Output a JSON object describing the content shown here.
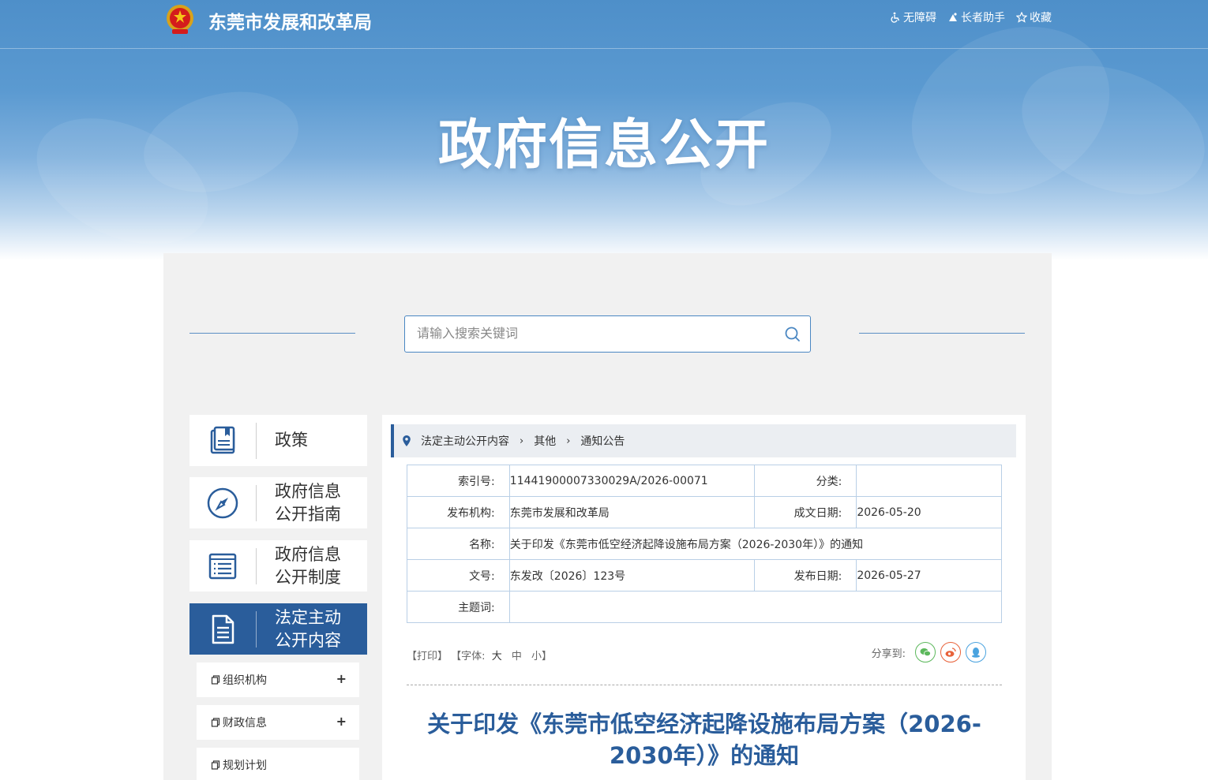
{
  "header": {
    "site_name": "东莞市发展和改革局",
    "tools": [
      {
        "label": "无障碍",
        "icon": "wheelchair-icon"
      },
      {
        "label": "长者助手",
        "icon": "elder-helper-icon"
      },
      {
        "label": "收藏",
        "icon": "star-icon"
      }
    ],
    "banner_title": "政府信息公开"
  },
  "search": {
    "placeholder": "请输入搜索关键词",
    "icon": "search-icon"
  },
  "sidebar": {
    "items": [
      {
        "label": "政策",
        "icon": "policy-book-icon",
        "active": false
      },
      {
        "label": "政府信息\n公开指南",
        "icon": "compass-icon",
        "active": false
      },
      {
        "label": "政府信息\n公开制度",
        "icon": "list-document-icon",
        "active": false
      },
      {
        "label": "法定主动\n公开内容",
        "icon": "document-icon",
        "active": true
      }
    ],
    "sub_items": [
      {
        "label": "组织机构",
        "expand": "+"
      },
      {
        "label": "财政信息",
        "expand": "+"
      },
      {
        "label": "规划计划",
        "expand": ""
      }
    ]
  },
  "breadcrumb": {
    "items": [
      "法定主动公开内容",
      "其他",
      "通知公告"
    ],
    "separator": "›"
  },
  "meta": {
    "index_label": "索引号:",
    "index_value": "11441900007330029A/2026-00071",
    "category_label": "分类:",
    "category_value": "",
    "issuer_label": "发布机构:",
    "issuer_value": "东莞市发展和改革局",
    "created_label": "成文日期:",
    "created_value": "2026-05-20",
    "name_label": "名称:",
    "name_value": "关于印发《东莞市低空经济起降设施布局方案（2026-2030年）》的通知",
    "docno_label": "文号:",
    "docno_value": "东发改〔2026〕123号",
    "published_label": "发布日期:",
    "published_value": "2026-05-27",
    "keywords_label": "主题词:",
    "keywords_value": ""
  },
  "article_tools": {
    "print": "【打印】",
    "font_prefix": "【字体:",
    "font_large": "大",
    "font_medium": "中",
    "font_small": "小",
    "font_suffix": "】",
    "share_label": "分享到:",
    "share_targets": [
      {
        "icon": "wechat-icon",
        "color": "#5cb85c"
      },
      {
        "icon": "weibo-icon",
        "color": "#e8623a"
      },
      {
        "icon": "qq-icon",
        "color": "#4aa3df"
      }
    ]
  },
  "article": {
    "title": "关于印发《东莞市低空经济起降设施布局方案（2026-2030年）》的通知"
  },
  "colors": {
    "primary": "#2a5d9b",
    "banner": "#5b9ad1",
    "panel": "#f1f1f1"
  }
}
